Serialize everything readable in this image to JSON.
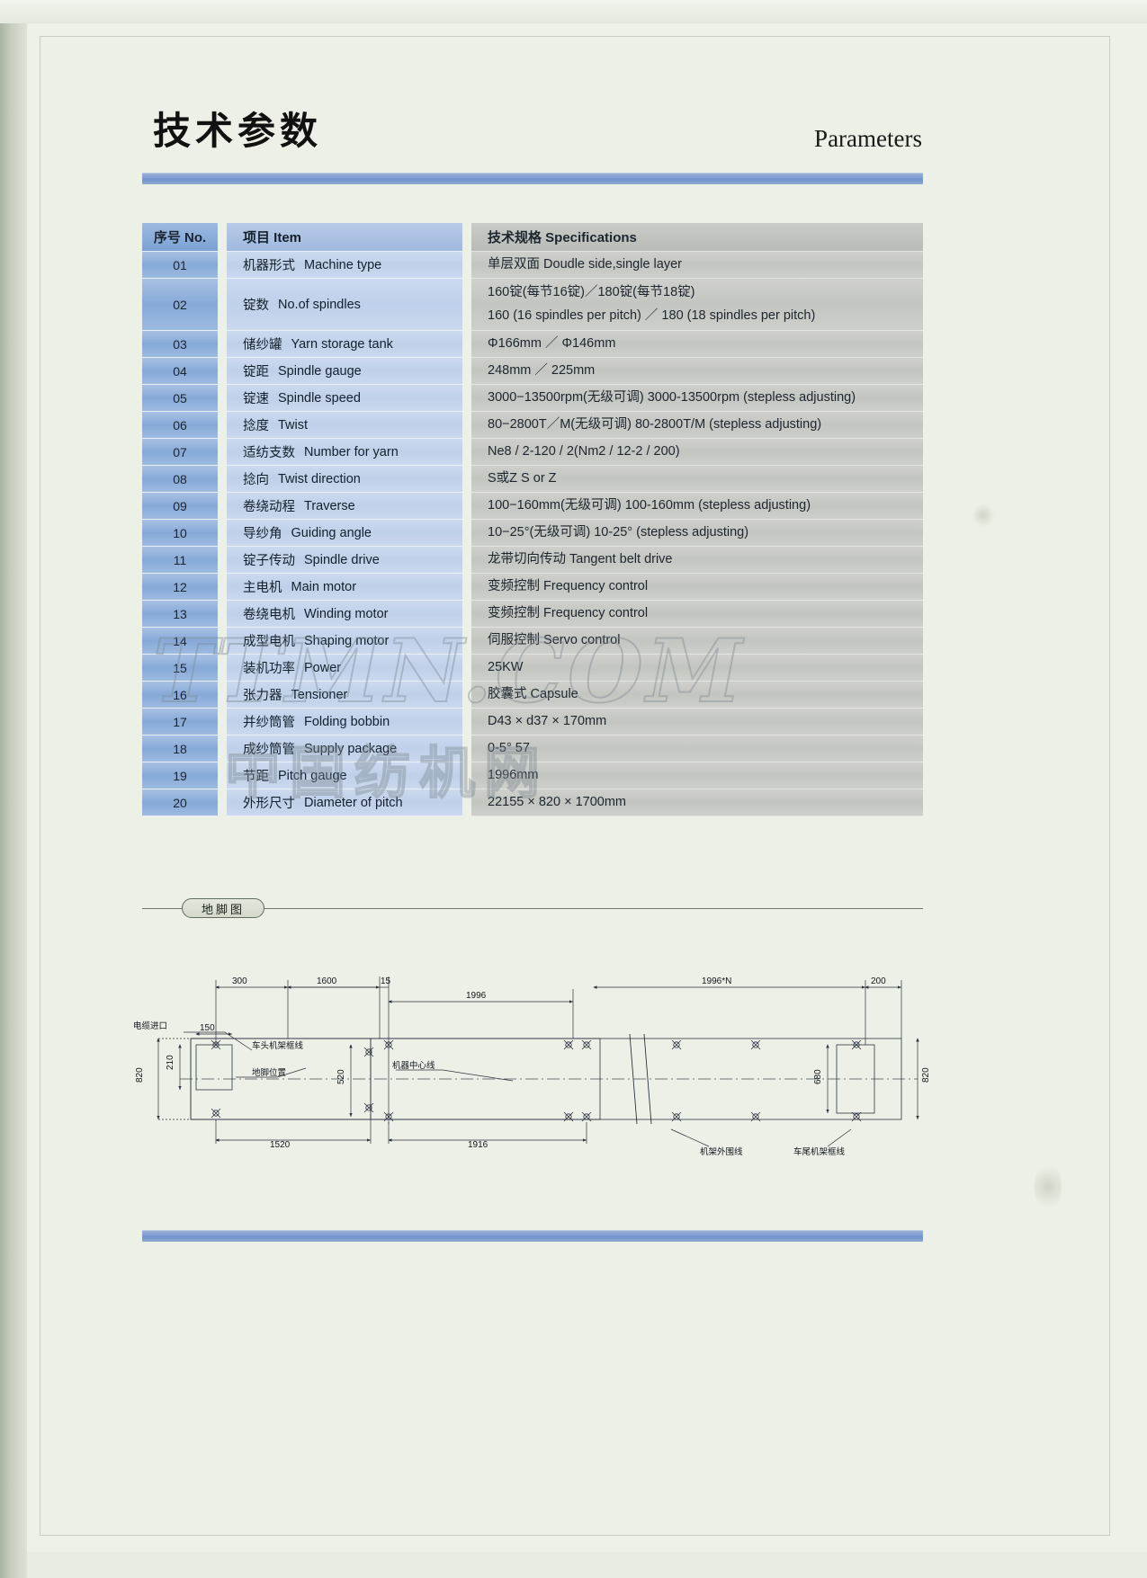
{
  "header": {
    "title_cn": "技术参数",
    "title_en": "Parameters"
  },
  "table": {
    "columns": {
      "no": "序号 No.",
      "item": "项目 Item",
      "spec": "技术规格 Specifications"
    },
    "rows": [
      {
        "no": "01",
        "item_cn": "机器形式",
        "item_en": "Machine type",
        "spec": [
          "单层双面  Doudle side,single layer"
        ]
      },
      {
        "no": "02",
        "item_cn": "锭数",
        "item_en": "No.of spindles",
        "spec": [
          "160锭(每节16锭)／180锭(每节18锭)",
          "160 (16 spindles per pitch) ／ 180 (18 spindles per pitch)"
        ]
      },
      {
        "no": "03",
        "item_cn": "储纱罐",
        "item_en": "Yarn storage tank",
        "spec": [
          "Φ166mm ／ Φ146mm"
        ]
      },
      {
        "no": "04",
        "item_cn": "锭距",
        "item_en": "Spindle gauge",
        "spec": [
          "248mm ／ 225mm"
        ]
      },
      {
        "no": "05",
        "item_cn": "锭速",
        "item_en": "Spindle speed",
        "spec": [
          "3000−13500rpm(无级可调)  3000-13500rpm (stepless adjusting)"
        ]
      },
      {
        "no": "06",
        "item_cn": "捻度",
        "item_en": "Twist",
        "spec": [
          "80−2800T／M(无级可调)  80-2800T/M (stepless adjusting)"
        ]
      },
      {
        "no": "07",
        "item_cn": "适纺支数",
        "item_en": "Number for yarn",
        "spec": [
          "Ne8 / 2-120 / 2(Nm2 / 12-2 / 200)"
        ]
      },
      {
        "no": "08",
        "item_cn": "捻向",
        "item_en": "Twist direction",
        "spec": [
          "S或Z   S or Z"
        ]
      },
      {
        "no": "09",
        "item_cn": "卷绕动程",
        "item_en": "Traverse",
        "spec": [
          "100−160mm(无级可调)  100-160mm (stepless adjusting)"
        ]
      },
      {
        "no": "10",
        "item_cn": "导纱角",
        "item_en": "Guiding angle",
        "spec": [
          "10−25°(无级可调)  10-25° (stepless adjusting)"
        ]
      },
      {
        "no": "11",
        "item_cn": "锭子传动",
        "item_en": "Spindle drive",
        "spec": [
          "龙带切向传动  Tangent belt drive"
        ]
      },
      {
        "no": "12",
        "item_cn": "主电机",
        "item_en": "Main motor",
        "spec": [
          "变频控制  Frequency control"
        ]
      },
      {
        "no": "13",
        "item_cn": "卷绕电机",
        "item_en": "Winding motor",
        "spec": [
          "变频控制  Frequency control"
        ]
      },
      {
        "no": "14",
        "item_cn": "成型电机",
        "item_en": "Shaping motor",
        "spec": [
          "伺服控制  Servo control"
        ]
      },
      {
        "no": "15",
        "item_cn": "装机功率",
        "item_en": "Power",
        "spec": [
          "25KW"
        ]
      },
      {
        "no": "16",
        "item_cn": "张力器",
        "item_en": "Tensioner",
        "spec": [
          "胶囊式  Capsule"
        ]
      },
      {
        "no": "17",
        "item_cn": "并纱筒管",
        "item_en": "Folding bobbin",
        "spec": [
          "D43 × d37 × 170mm"
        ]
      },
      {
        "no": "18",
        "item_cn": "成纱筒管",
        "item_en": "Supply package",
        "spec": [
          "0-5°  57"
        ]
      },
      {
        "no": "19",
        "item_cn": "节距",
        "item_en": "Pitch gauge",
        "spec": [
          "1996mm"
        ]
      },
      {
        "no": "20",
        "item_cn": "外形尺寸",
        "item_en": "Diameter of pitch",
        "spec": [
          "22155 × 820 × 1700mm"
        ]
      }
    ]
  },
  "section": {
    "label": "地脚图"
  },
  "drawing": {
    "dimensions": {
      "d300": "300",
      "d1600": "1600",
      "d15": "15",
      "d1996": "1996",
      "d1996n": "1996*N",
      "d200": "200",
      "d820_left": "820",
      "d820_right": "820",
      "d210": "210",
      "d150": "150",
      "d520": "520",
      "d680": "680",
      "d1520": "1520",
      "d1916": "1916"
    },
    "labels": {
      "cable_inlet": "电缆进口",
      "head_frame_outline": "车头机架框线",
      "machine_center_line": "机器中心线",
      "anchor_position": "地脚位置",
      "frame_outer_line": "机架外围线",
      "tail_frame_outline": "车尾机架框线"
    }
  },
  "watermark": {
    "line1": "TTMN.COM",
    "line2": "中国纺机网"
  },
  "colors": {
    "accent_bar": "#7c9bd0",
    "no_column": "#87a9d8",
    "item_column": "#bfd0ea",
    "spec_column": "#c3c5c0",
    "page_bg": "#eef1e8"
  }
}
